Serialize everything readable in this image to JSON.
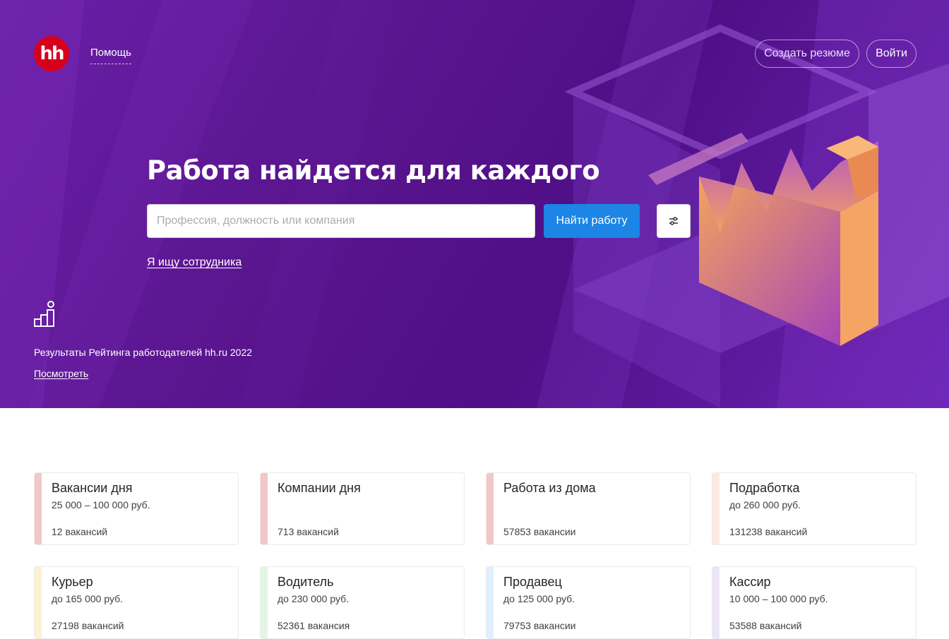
{
  "header": {
    "logo_text": "hh",
    "help_label": "Помощь",
    "create_resume_label": "Создать резюме",
    "login_label": "Войти"
  },
  "hero": {
    "title": "Работа найдется для каждого",
    "search_placeholder": "Профессия, должность или компания",
    "search_value": "",
    "search_button_label": "Найти работу",
    "filters_icon": "sliders-icon",
    "employer_link_label": "Я ищу сотрудника",
    "rating_icon": "rating-bars-icon",
    "rating_text": "Результаты Рейтинга работодателей hh.ru 2022",
    "rating_link_label": "Посмотреть"
  },
  "cards": [
    {
      "title": "Вакансии дня",
      "salary": "25 000 – 100 000 руб.",
      "count": "12 вакансий",
      "accent": "#f2c7c7"
    },
    {
      "title": "Компании дня",
      "salary": "",
      "count": "713 вакансий",
      "accent": "#f2c7c7"
    },
    {
      "title": "Работа из дома",
      "salary": "",
      "count": "57853 вакансии",
      "accent": "#f2c7c7"
    },
    {
      "title": "Подработка",
      "salary": "до 260 000 руб.",
      "count": "131238 вакансий",
      "accent": "#fde9dd"
    },
    {
      "title": "Курьер",
      "salary": "до 165 000 руб.",
      "count": "27198 вакансий",
      "accent": "#fdf1d2"
    },
    {
      "title": "Водитель",
      "salary": "до 230 000 руб.",
      "count": "52361 вакансия",
      "accent": "#e3f6e3"
    },
    {
      "title": "Продавец",
      "salary": "до 125 000 руб.",
      "count": "79753 вакансии",
      "accent": "#dfeffd"
    },
    {
      "title": "Кассир",
      "salary": "10 000 – 100 000 руб.",
      "count": "53588 вакансий",
      "accent": "#ece5f8"
    }
  ]
}
